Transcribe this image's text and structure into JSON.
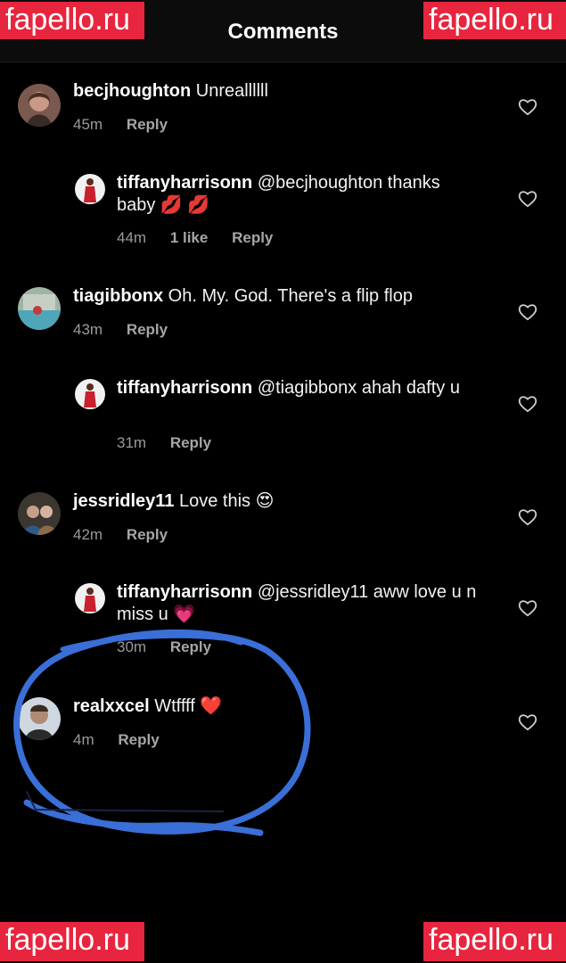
{
  "header": {
    "title": "Comments"
  },
  "watermarks": {
    "top_left": "fapello.ru",
    "top_right": "fapello.ru",
    "bottom_left": "fapello.ru",
    "bottom_right": "fapello.ru"
  },
  "comments": [
    {
      "username": "becjhoughton",
      "text": "Unreallllll",
      "time": "45m",
      "likes": "",
      "reply": "Reply"
    },
    {
      "username": "tiffanyharrisonn",
      "text": "@becjhoughton thanks baby 💋 💋",
      "time": "44m",
      "likes": "1 like",
      "reply": "Reply"
    },
    {
      "username": "tiagibbonx",
      "text": "Oh. My. God. There's a flip flop",
      "time": "43m",
      "likes": "",
      "reply": "Reply"
    },
    {
      "username": "tiffanyharrisonn",
      "text": "@tiagibbonx ahah dafty u",
      "time": "31m",
      "likes": "",
      "reply": "Reply"
    },
    {
      "username": "jessridley11",
      "text": "Love this 😍",
      "time": "42m",
      "likes": "",
      "reply": "Reply"
    },
    {
      "username": "tiffanyharrisonn",
      "text": "@jessridley11 aww love u n miss u 💗",
      "time": "30m",
      "likes": "",
      "reply": "Reply"
    },
    {
      "username": "realxxcel",
      "text": "Wtffff ❤️",
      "time": "4m",
      "likes": "",
      "reply": "Reply"
    }
  ],
  "colors": {
    "background": "#000000",
    "header_bg": "#0c0c0c",
    "watermark_bg": "#e8253e",
    "scribble": "#3a6fd8",
    "meta_text": "#9a9a9a"
  },
  "icons": {
    "back": "chevron-left-icon",
    "share": "share-icon",
    "like": "heart-outline-icon"
  }
}
